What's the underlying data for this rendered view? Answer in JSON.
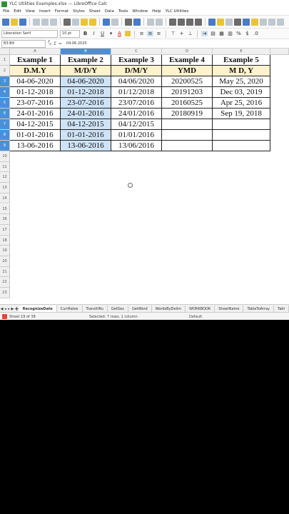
{
  "window": {
    "title": "YLC Utilities Examples.xlsx — LibreOffice Calc"
  },
  "menu": [
    "File",
    "Edit",
    "View",
    "Insert",
    "Format",
    "Styles",
    "Sheet",
    "Data",
    "Tools",
    "Window",
    "Help",
    "YLC Utilities"
  ],
  "format": {
    "font": "Liberation Serif",
    "size": "10 pt"
  },
  "formula": {
    "cell_ref": "B3:B9",
    "value": "04.06.2020"
  },
  "columns": [
    "A",
    "B",
    "C",
    "D",
    "E"
  ],
  "rows": [
    "1",
    "2",
    "3",
    "4",
    "5",
    "6",
    "7",
    "8",
    "9",
    "10",
    "11",
    "12",
    "13",
    "14",
    "15",
    "16",
    "17",
    "18",
    "19",
    "20",
    "21",
    "22",
    "23"
  ],
  "sheet": {
    "headers": [
      "Example 1",
      "Example 2",
      "Example 3",
      "Example 4",
      "Example 5"
    ],
    "formats": [
      "D.M.Y",
      "M/D/Y",
      "D/M/Y",
      "YMD",
      "M D, Y"
    ],
    "data": [
      [
        "04-06-2020",
        "04-06-2020",
        "04/06/2020",
        "20200525",
        "May 25, 2020"
      ],
      [
        "01-12-2018",
        "01-12-2018",
        "01/12/2018",
        "20191203",
        "Dec 03, 2019"
      ],
      [
        "23-07-2016",
        "23-07-2016",
        "23/07/2016",
        "20160525",
        "Apr 25, 2016"
      ],
      [
        "24-01-2016",
        "24-01-2016",
        "24/01/2016",
        "20180919",
        "Sep 19, 2018"
      ],
      [
        "04-12-2015",
        "04-12-2015",
        "04/12/2015",
        "",
        ""
      ],
      [
        "01-01-2016",
        "01-01-2016",
        "01/01/2016",
        "",
        ""
      ],
      [
        "13-06-2016",
        "13-06-2016",
        "13/06/2016",
        "",
        ""
      ]
    ]
  },
  "tabs": [
    "RecognizeDate",
    "CurrRates",
    "TranslitRu",
    "GetSex",
    "GetWord",
    "WordsByDelim",
    "WORKBOOK",
    "SheetName",
    "TableToArray",
    "Tabl"
  ],
  "status": {
    "sheet": "Sheet 19 of 38",
    "selection": "Selected: 7 rows, 1 column",
    "style": "Default"
  }
}
